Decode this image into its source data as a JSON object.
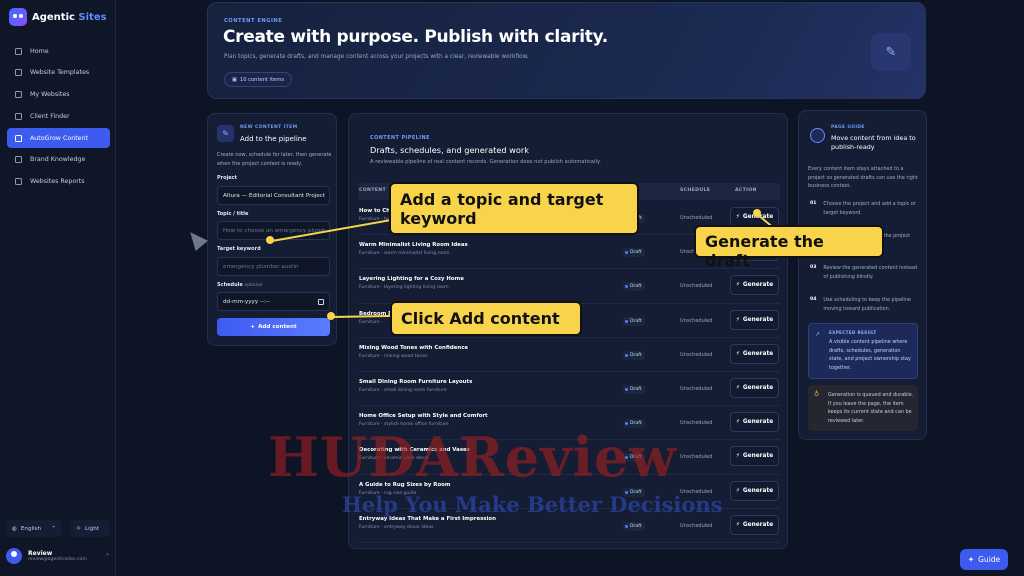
{
  "brand": {
    "name_a": "Agentic ",
    "name_b": "Sites"
  },
  "sidebar": {
    "items": [
      {
        "label": "Home",
        "icon": "home-icon"
      },
      {
        "label": "Website Templates",
        "icon": "templates-icon"
      },
      {
        "label": "My Websites",
        "icon": "folder-icon"
      },
      {
        "label": "Client Finder",
        "icon": "finder-icon"
      },
      {
        "label": "AutoGrow Content",
        "icon": "calendar-icon",
        "active": true
      },
      {
        "label": "Brand Knowledge",
        "icon": "book-icon"
      },
      {
        "label": "Websites Reports",
        "icon": "report-icon"
      }
    ],
    "language": "English",
    "theme": "Light",
    "user": {
      "name": "Review",
      "email": "review@agenticsites.com"
    }
  },
  "hero": {
    "eyebrow": "CONTENT ENGINE",
    "title": "Create with purpose. Publish with clarity.",
    "description": "Plan topics, generate drafts, and manage content across your projects with a clear, reviewable workflow.",
    "badge": "10 content items"
  },
  "new_item": {
    "eyebrow": "NEW CONTENT ITEM",
    "title": "Add to the pipeline",
    "description": "Create now, schedule for later, then generate when the project context is ready.",
    "project_label": "Project",
    "project_value": "Altura — Editorial Consultant Project",
    "topic_label": "Topic / title",
    "topic_placeholder": "How to choose an emergency plumb",
    "keyword_label": "Target keyword",
    "keyword_placeholder": "emergency plumber austin",
    "schedule_label": "Schedule",
    "schedule_optional": "optional",
    "schedule_placeholder": "dd-mm-yyyy --:--",
    "add_button": "Add content"
  },
  "pipeline": {
    "eyebrow": "CONTENT PIPELINE",
    "title": "Drafts, schedules, and generated work",
    "description": "A reviewable pipeline of real content records. Generation does not publish automatically.",
    "col_content": "CONTENT",
    "col_schedule": "SCHEDULE",
    "col_action": "ACTION",
    "rows": [
      {
        "title": "How to Choo",
        "sub": "Furniture · how",
        "status": "Draft",
        "schedule": "Unscheduled",
        "action": "Generate"
      },
      {
        "title": "Warm Minimalist Living Room Ideas",
        "sub": "Furniture · warm minimalist living room",
        "status": "Draft",
        "schedule": "Unscheduled",
        "action": "Generate"
      },
      {
        "title": "Layering Lighting for a Cozy Home",
        "sub": "Furniture · layering lighting living room",
        "status": "Draft",
        "schedule": "Unscheduled",
        "action": "Generate"
      },
      {
        "title": "Bedroom Re",
        "sub": "Furniture ·",
        "status": "Draft",
        "schedule": "Unscheduled",
        "action": "Generate"
      },
      {
        "title": "Mixing Wood Tones with Confidence",
        "sub": "Furniture · mixing wood tones",
        "status": "Draft",
        "schedule": "Unscheduled",
        "action": "Generate"
      },
      {
        "title": "Small Dining Room Furniture Layouts",
        "sub": "Furniture · small dining room furniture",
        "status": "Draft",
        "schedule": "Unscheduled",
        "action": "Generate"
      },
      {
        "title": "Home Office Setup with Style and Comfort",
        "sub": "Furniture · stylish home office furniture",
        "status": "Draft",
        "schedule": "Unscheduled",
        "action": "Generate"
      },
      {
        "title": "Decorating with Ceramics and Vases",
        "sub": "Furniture · ceramic vase decor",
        "status": "Draft",
        "schedule": "Unscheduled",
        "action": "Generate"
      },
      {
        "title": "A Guide to Rug Sizes by Room",
        "sub": "Furniture · rug size guide",
        "status": "Draft",
        "schedule": "Unscheduled",
        "action": "Generate"
      },
      {
        "title": "Entryway Ideas That Make a First Impression",
        "sub": "Furniture · entryway decor ideas",
        "status": "Draft",
        "schedule": "Unscheduled",
        "action": "Generate"
      }
    ]
  },
  "guide": {
    "eyebrow": "PAGE GUIDE",
    "title": "Move content from idea to publish-ready",
    "description": "Every content item stays attached to a project so generated drafts can use the right business context.",
    "steps": [
      {
        "num": "01",
        "text": "Choose the project and add a topic or target keyword."
      },
      {
        "num": "02",
        "text": "Generate the draft from the project"
      },
      {
        "num": "03",
        "text": "Review the generated content instead of publishing blindly."
      },
      {
        "num": "04",
        "text": "Use scheduling to keep the pipeline moving toward publication."
      }
    ],
    "expected_heading": "EXPECTED RESULT",
    "expected_body": "A visible content pipeline where drafts, schedules, generation state, and project ownership stay together.",
    "note": "Generation is queued and durable. If you leave the page, the item keeps its current state and can be reviewed later."
  },
  "annotations": {
    "topic": "Add a topic and target keyword",
    "generate": "Generate the draft",
    "add": "Click Add content"
  },
  "watermark": {
    "main": "HUDAReview",
    "tagline": "Help You Make Better Decisions"
  },
  "guide_button": "Guide",
  "colors": {
    "accent": "#3e5bf0",
    "callout": "#f7d44a",
    "background": "#0d1426"
  }
}
